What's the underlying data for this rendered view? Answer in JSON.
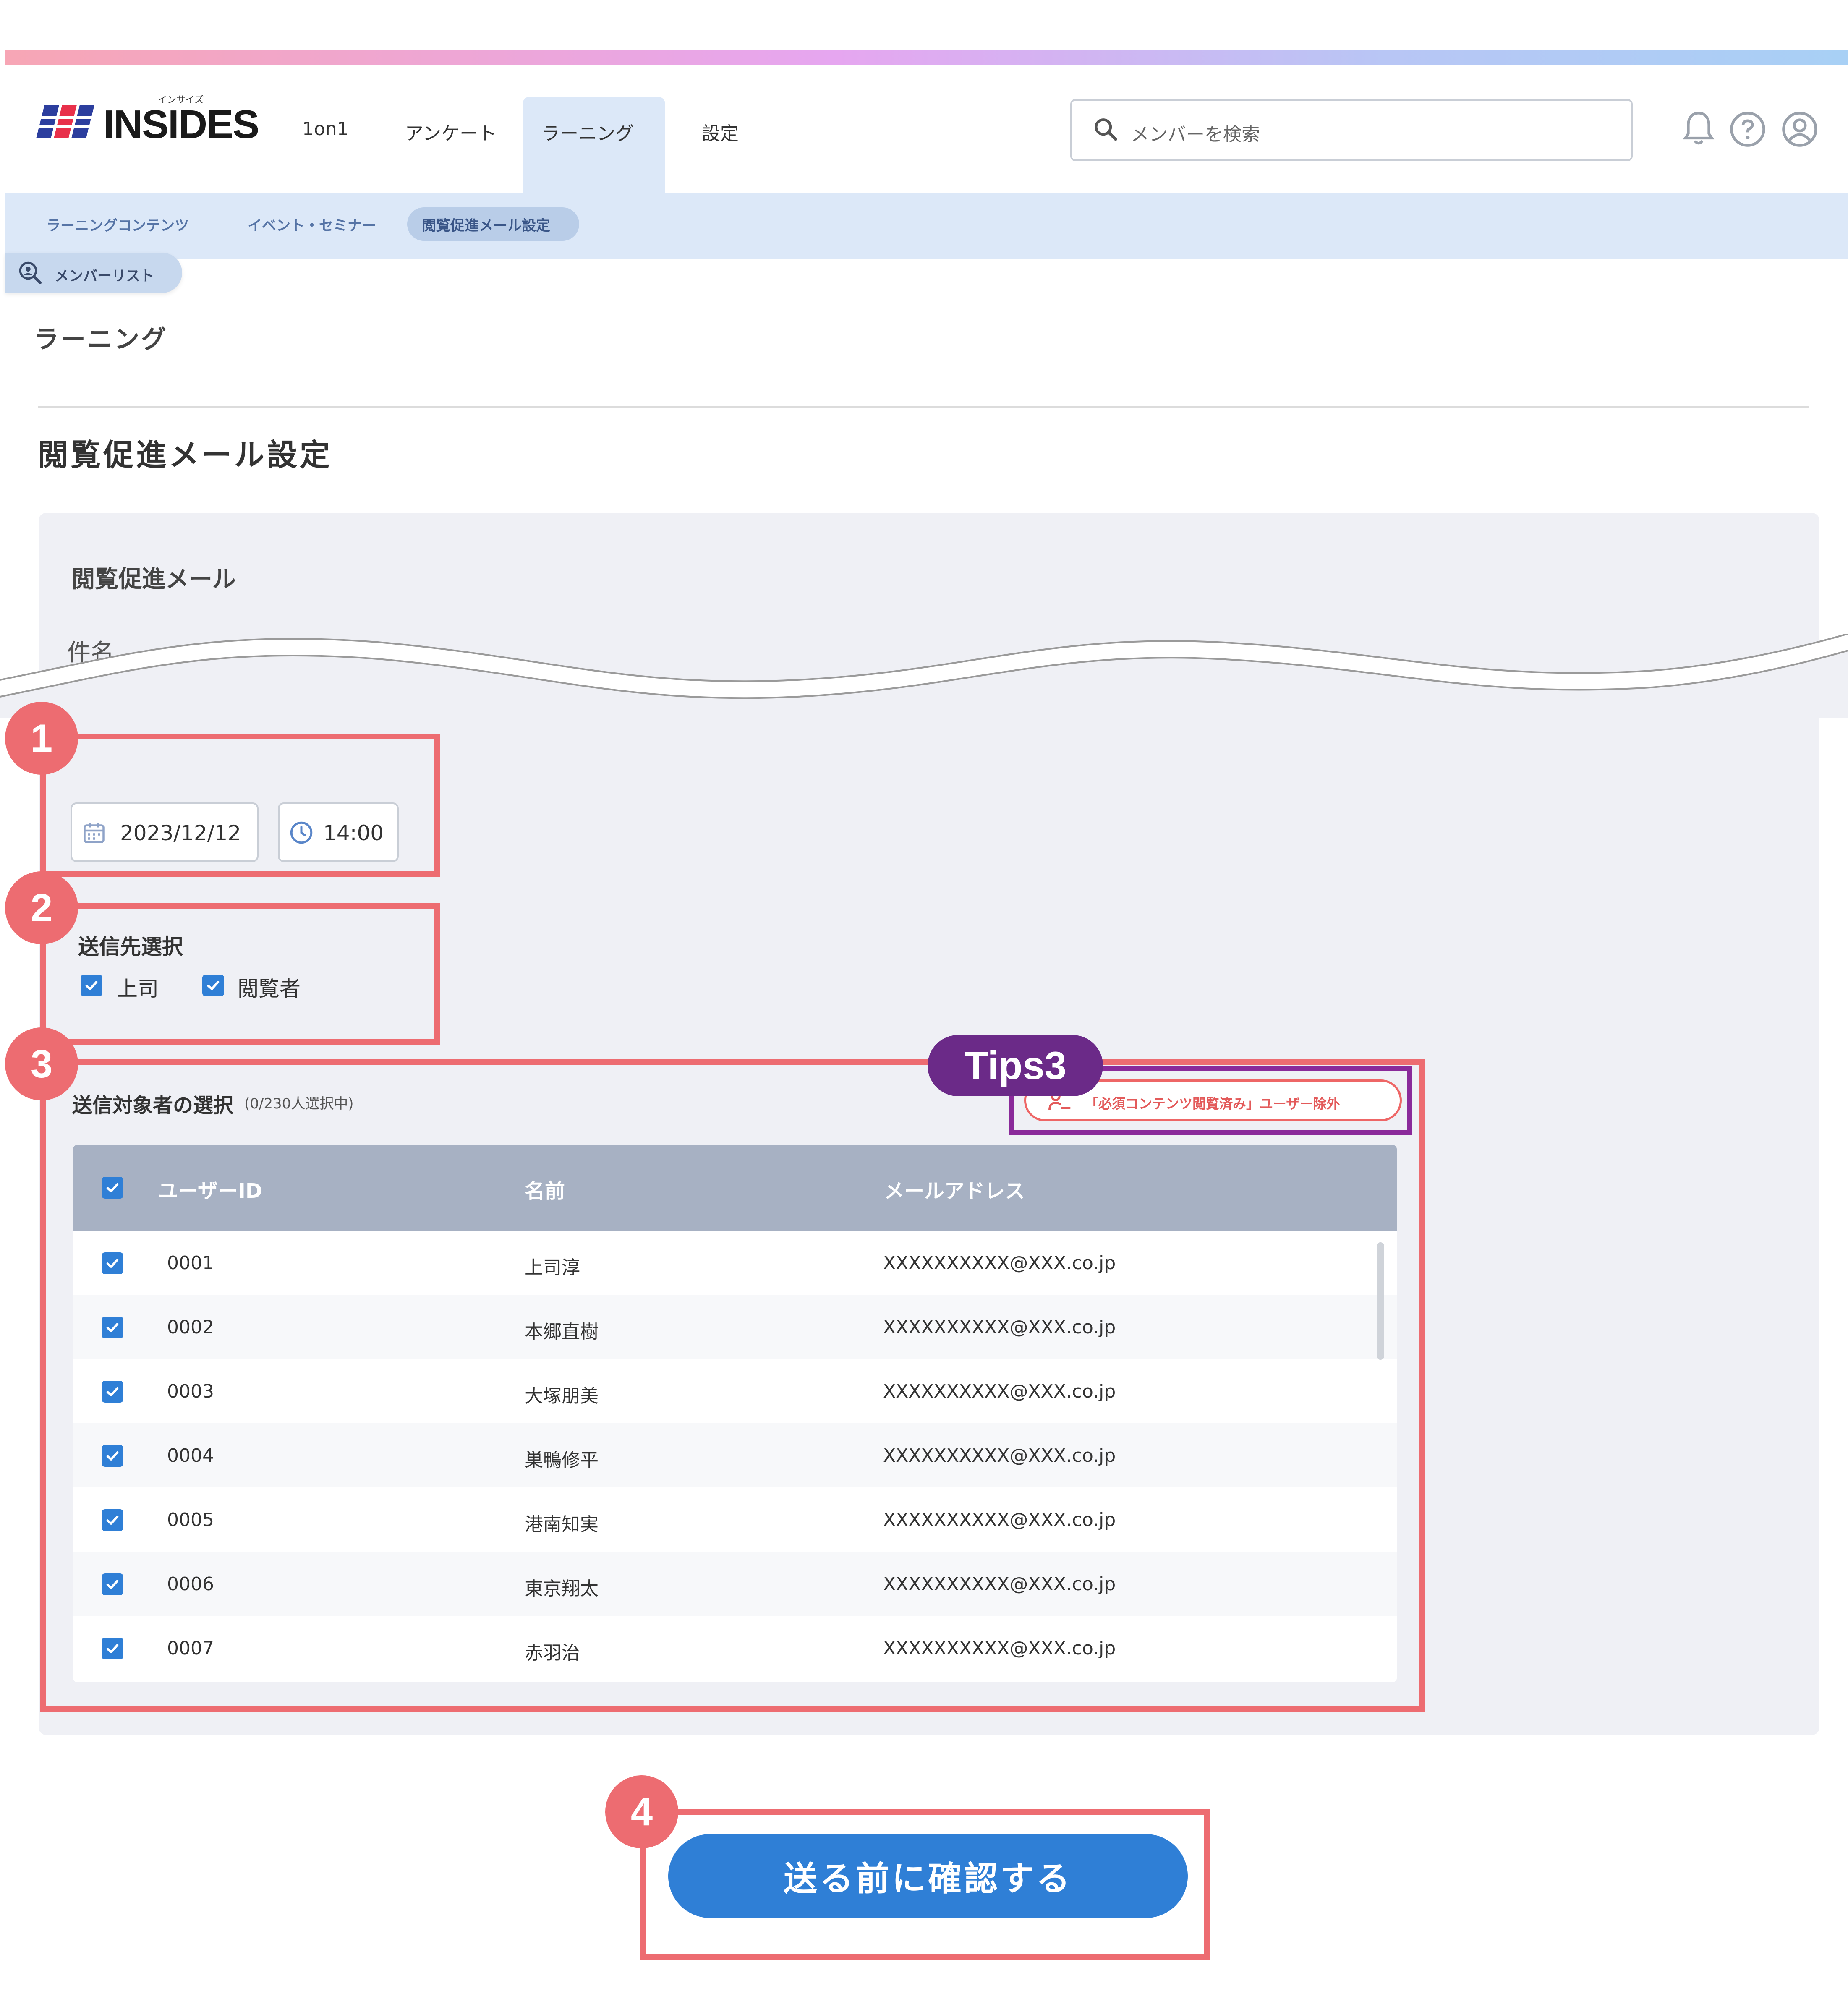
{
  "header": {
    "logo_text": "INSIDES",
    "logo_small": "インサイズ",
    "nav": [
      "1on1",
      "アンケート",
      "ラーニング",
      "設定"
    ],
    "search_placeholder": "メンバーを検索"
  },
  "subnav": {
    "items": [
      "ラーニングコンテンツ",
      "イベント・セミナー",
      "閲覧促進メール設定"
    ],
    "member_list": "メンバーリスト"
  },
  "page": {
    "section": "ラーニング",
    "title": "閲覧促進メール設定",
    "panel_heading": "閲覧促進メール",
    "subject_label": "件名"
  },
  "badges": [
    "1",
    "2",
    "3",
    "4"
  ],
  "schedule": {
    "date": "2023/12/12",
    "time": "14:00"
  },
  "recipients": {
    "label": "送信先選択",
    "options": [
      "上司",
      "閲覧者"
    ]
  },
  "targets": {
    "label": "送信対象者の選択",
    "count": "(0/230人選択中)",
    "tips_label": "Tips3",
    "exclude_button": "「必須コンテンツ閲覧済み」ユーザー除外",
    "columns": [
      "ユーザーID",
      "名前",
      "メールアドレス"
    ],
    "rows": [
      {
        "id": "0001",
        "name": "上司淳",
        "email": "XXXXXXXXXX@XXX.co.jp"
      },
      {
        "id": "0002",
        "name": "本郷直樹",
        "email": "XXXXXXXXXX@XXX.co.jp"
      },
      {
        "id": "0003",
        "name": "大塚朋美",
        "email": "XXXXXXXXXX@XXX.co.jp"
      },
      {
        "id": "0004",
        "name": "巣鴨修平",
        "email": "XXXXXXXXXX@XXX.co.jp"
      },
      {
        "id": "0005",
        "name": "港南知実",
        "email": "XXXXXXXXXX@XXX.co.jp"
      },
      {
        "id": "0006",
        "name": "東京翔太",
        "email": "XXXXXXXXXX@XXX.co.jp"
      },
      {
        "id": "0007",
        "name": "赤羽治",
        "email": "XXXXXXXXXX@XXX.co.jp"
      }
    ]
  },
  "cta": "送る前に確認する",
  "colors": {
    "accent": "#2f7fd6",
    "highlight": "#ed6c71",
    "tips": "#6b2a88"
  },
  "icons": [
    "search-icon",
    "bell-icon",
    "help-icon",
    "user-icon",
    "calendar-icon",
    "clock-icon",
    "checkbox-checked-icon",
    "person-minus-icon"
  ]
}
